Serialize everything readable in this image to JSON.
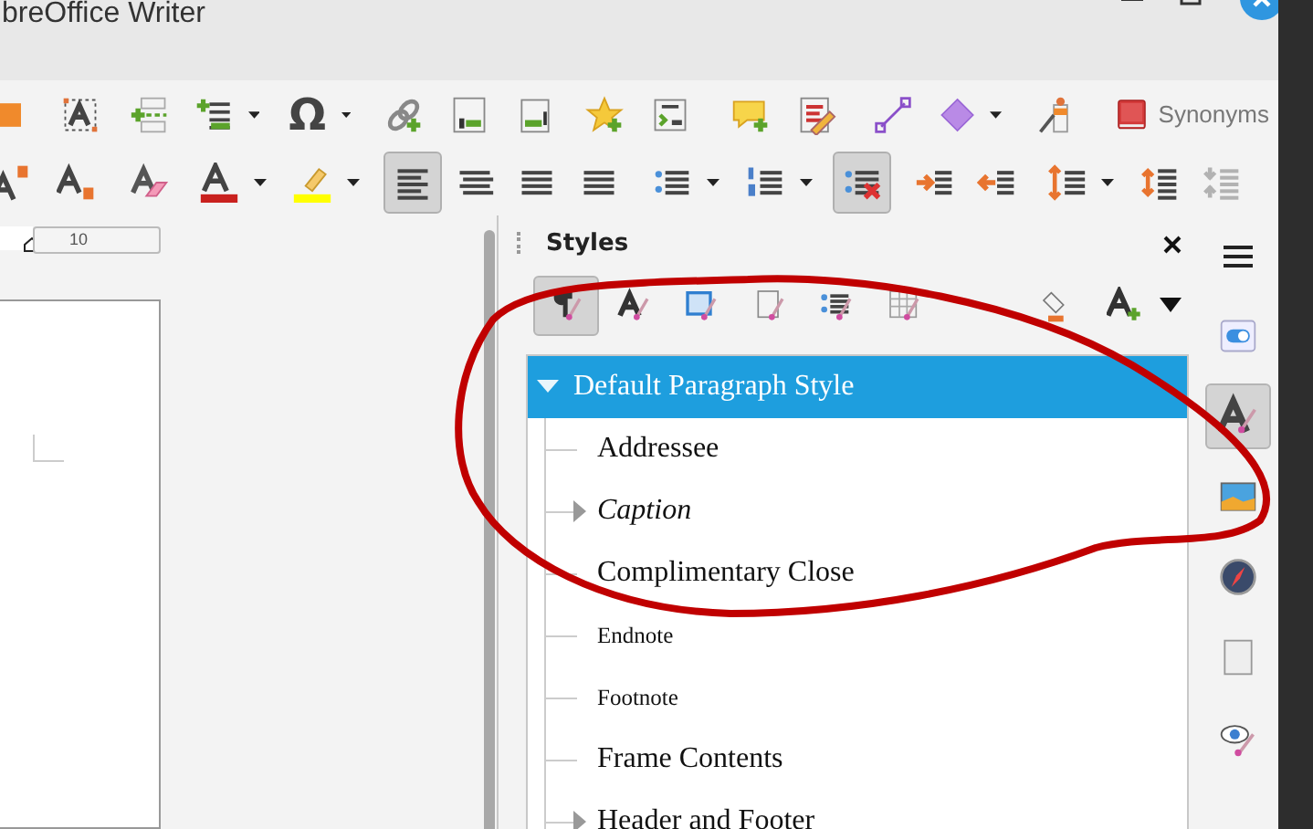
{
  "window": {
    "title": "breOffice Writer"
  },
  "toolbars": [
    [
      {
        "kind": "icon",
        "dropdown": false,
        "pressed": false,
        "disabled": false
      },
      {
        "kind": "icon",
        "dropdown": false,
        "pressed": false,
        "disabled": false
      },
      {
        "kind": "icon",
        "dropdown": false,
        "pressed": false,
        "disabled": false
      },
      {
        "kind": "icon",
        "dropdown": true,
        "pressed": false,
        "disabled": false
      },
      {
        "kind": "glyph",
        "text": "Ω",
        "dropdown": true,
        "pressed": false,
        "disabled": false
      },
      {
        "kind": "icon",
        "dropdown": false,
        "pressed": false,
        "disabled": false
      },
      {
        "kind": "icon",
        "dropdown": false,
        "pressed": false,
        "disabled": false
      },
      {
        "kind": "icon",
        "dropdown": false,
        "pressed": false,
        "disabled": false
      },
      {
        "kind": "icon",
        "dropdown": false,
        "pressed": false,
        "disabled": false
      },
      {
        "kind": "icon",
        "dropdown": false,
        "pressed": false,
        "disabled": false
      },
      {
        "kind": "icon",
        "dropdown": false,
        "pressed": false,
        "disabled": false
      },
      {
        "kind": "icon",
        "dropdown": false,
        "pressed": false,
        "disabled": false
      },
      {
        "kind": "icon",
        "dropdown": false,
        "pressed": false,
        "disabled": false
      },
      {
        "kind": "icon",
        "dropdown": true,
        "pressed": false,
        "disabled": false
      },
      {
        "kind": "icon",
        "dropdown": false,
        "pressed": false,
        "disabled": false
      },
      {
        "kind": "labeled",
        "label": "Synonyms",
        "dropdown": false,
        "pressed": false,
        "disabled": false
      }
    ],
    [
      {
        "kind": "icon",
        "dropdown": false,
        "pressed": false,
        "disabled": false
      },
      {
        "kind": "icon",
        "dropdown": false,
        "pressed": false,
        "disabled": false
      },
      {
        "kind": "icon",
        "dropdown": false,
        "pressed": false,
        "disabled": false
      },
      {
        "kind": "icon",
        "dropdown": true,
        "pressed": false,
        "disabled": false
      },
      {
        "kind": "icon",
        "dropdown": true,
        "pressed": false,
        "disabled": false
      },
      {
        "kind": "icon",
        "dropdown": false,
        "pressed": true,
        "disabled": false
      },
      {
        "kind": "icon",
        "dropdown": false,
        "pressed": false,
        "disabled": false
      },
      {
        "kind": "icon",
        "dropdown": false,
        "pressed": false,
        "disabled": false
      },
      {
        "kind": "icon",
        "dropdown": false,
        "pressed": false,
        "disabled": false
      },
      {
        "kind": "icon",
        "dropdown": true,
        "pressed": false,
        "disabled": false
      },
      {
        "kind": "icon",
        "dropdown": true,
        "pressed": false,
        "disabled": false
      },
      {
        "kind": "icon",
        "dropdown": false,
        "pressed": true,
        "disabled": false
      },
      {
        "kind": "icon",
        "dropdown": false,
        "pressed": false,
        "disabled": false
      },
      {
        "kind": "icon",
        "dropdown": false,
        "pressed": false,
        "disabled": false
      },
      {
        "kind": "icon",
        "dropdown": true,
        "pressed": false,
        "disabled": false
      },
      {
        "kind": "icon",
        "dropdown": false,
        "pressed": false,
        "disabled": false
      },
      {
        "kind": "icon",
        "dropdown": false,
        "pressed": false,
        "disabled": true
      }
    ]
  ],
  "ruler": {
    "mark": "10"
  },
  "styles_panel": {
    "title": "Styles",
    "categories": [
      {
        "selected": true
      },
      {
        "selected": false
      },
      {
        "selected": false
      },
      {
        "selected": false
      },
      {
        "selected": false
      },
      {
        "selected": false
      }
    ],
    "tree": [
      {
        "label": "Default Paragraph Style",
        "selected": true,
        "expanded": true,
        "kind": "regular",
        "children": [
          {
            "label": "Addressee",
            "selected": false,
            "kind": "regular",
            "expandable": false
          },
          {
            "label": "Caption",
            "selected": false,
            "kind": "italic",
            "expandable": true
          },
          {
            "label": "Complimentary Close",
            "selected": false,
            "kind": "regular",
            "expandable": false
          },
          {
            "label": "Endnote",
            "selected": false,
            "kind": "small",
            "expandable": false
          },
          {
            "label": "Footnote",
            "selected": false,
            "kind": "small",
            "expandable": false
          },
          {
            "label": "Frame Contents",
            "selected": false,
            "kind": "regular",
            "expandable": false
          },
          {
            "label": "Header and Footer",
            "selected": false,
            "kind": "regular",
            "expandable": true
          }
        ]
      }
    ]
  },
  "deck": {
    "tabs": [
      {
        "selected": false
      },
      {
        "selected": true
      },
      {
        "selected": false
      },
      {
        "selected": false
      },
      {
        "selected": false
      },
      {
        "selected": false
      }
    ]
  }
}
